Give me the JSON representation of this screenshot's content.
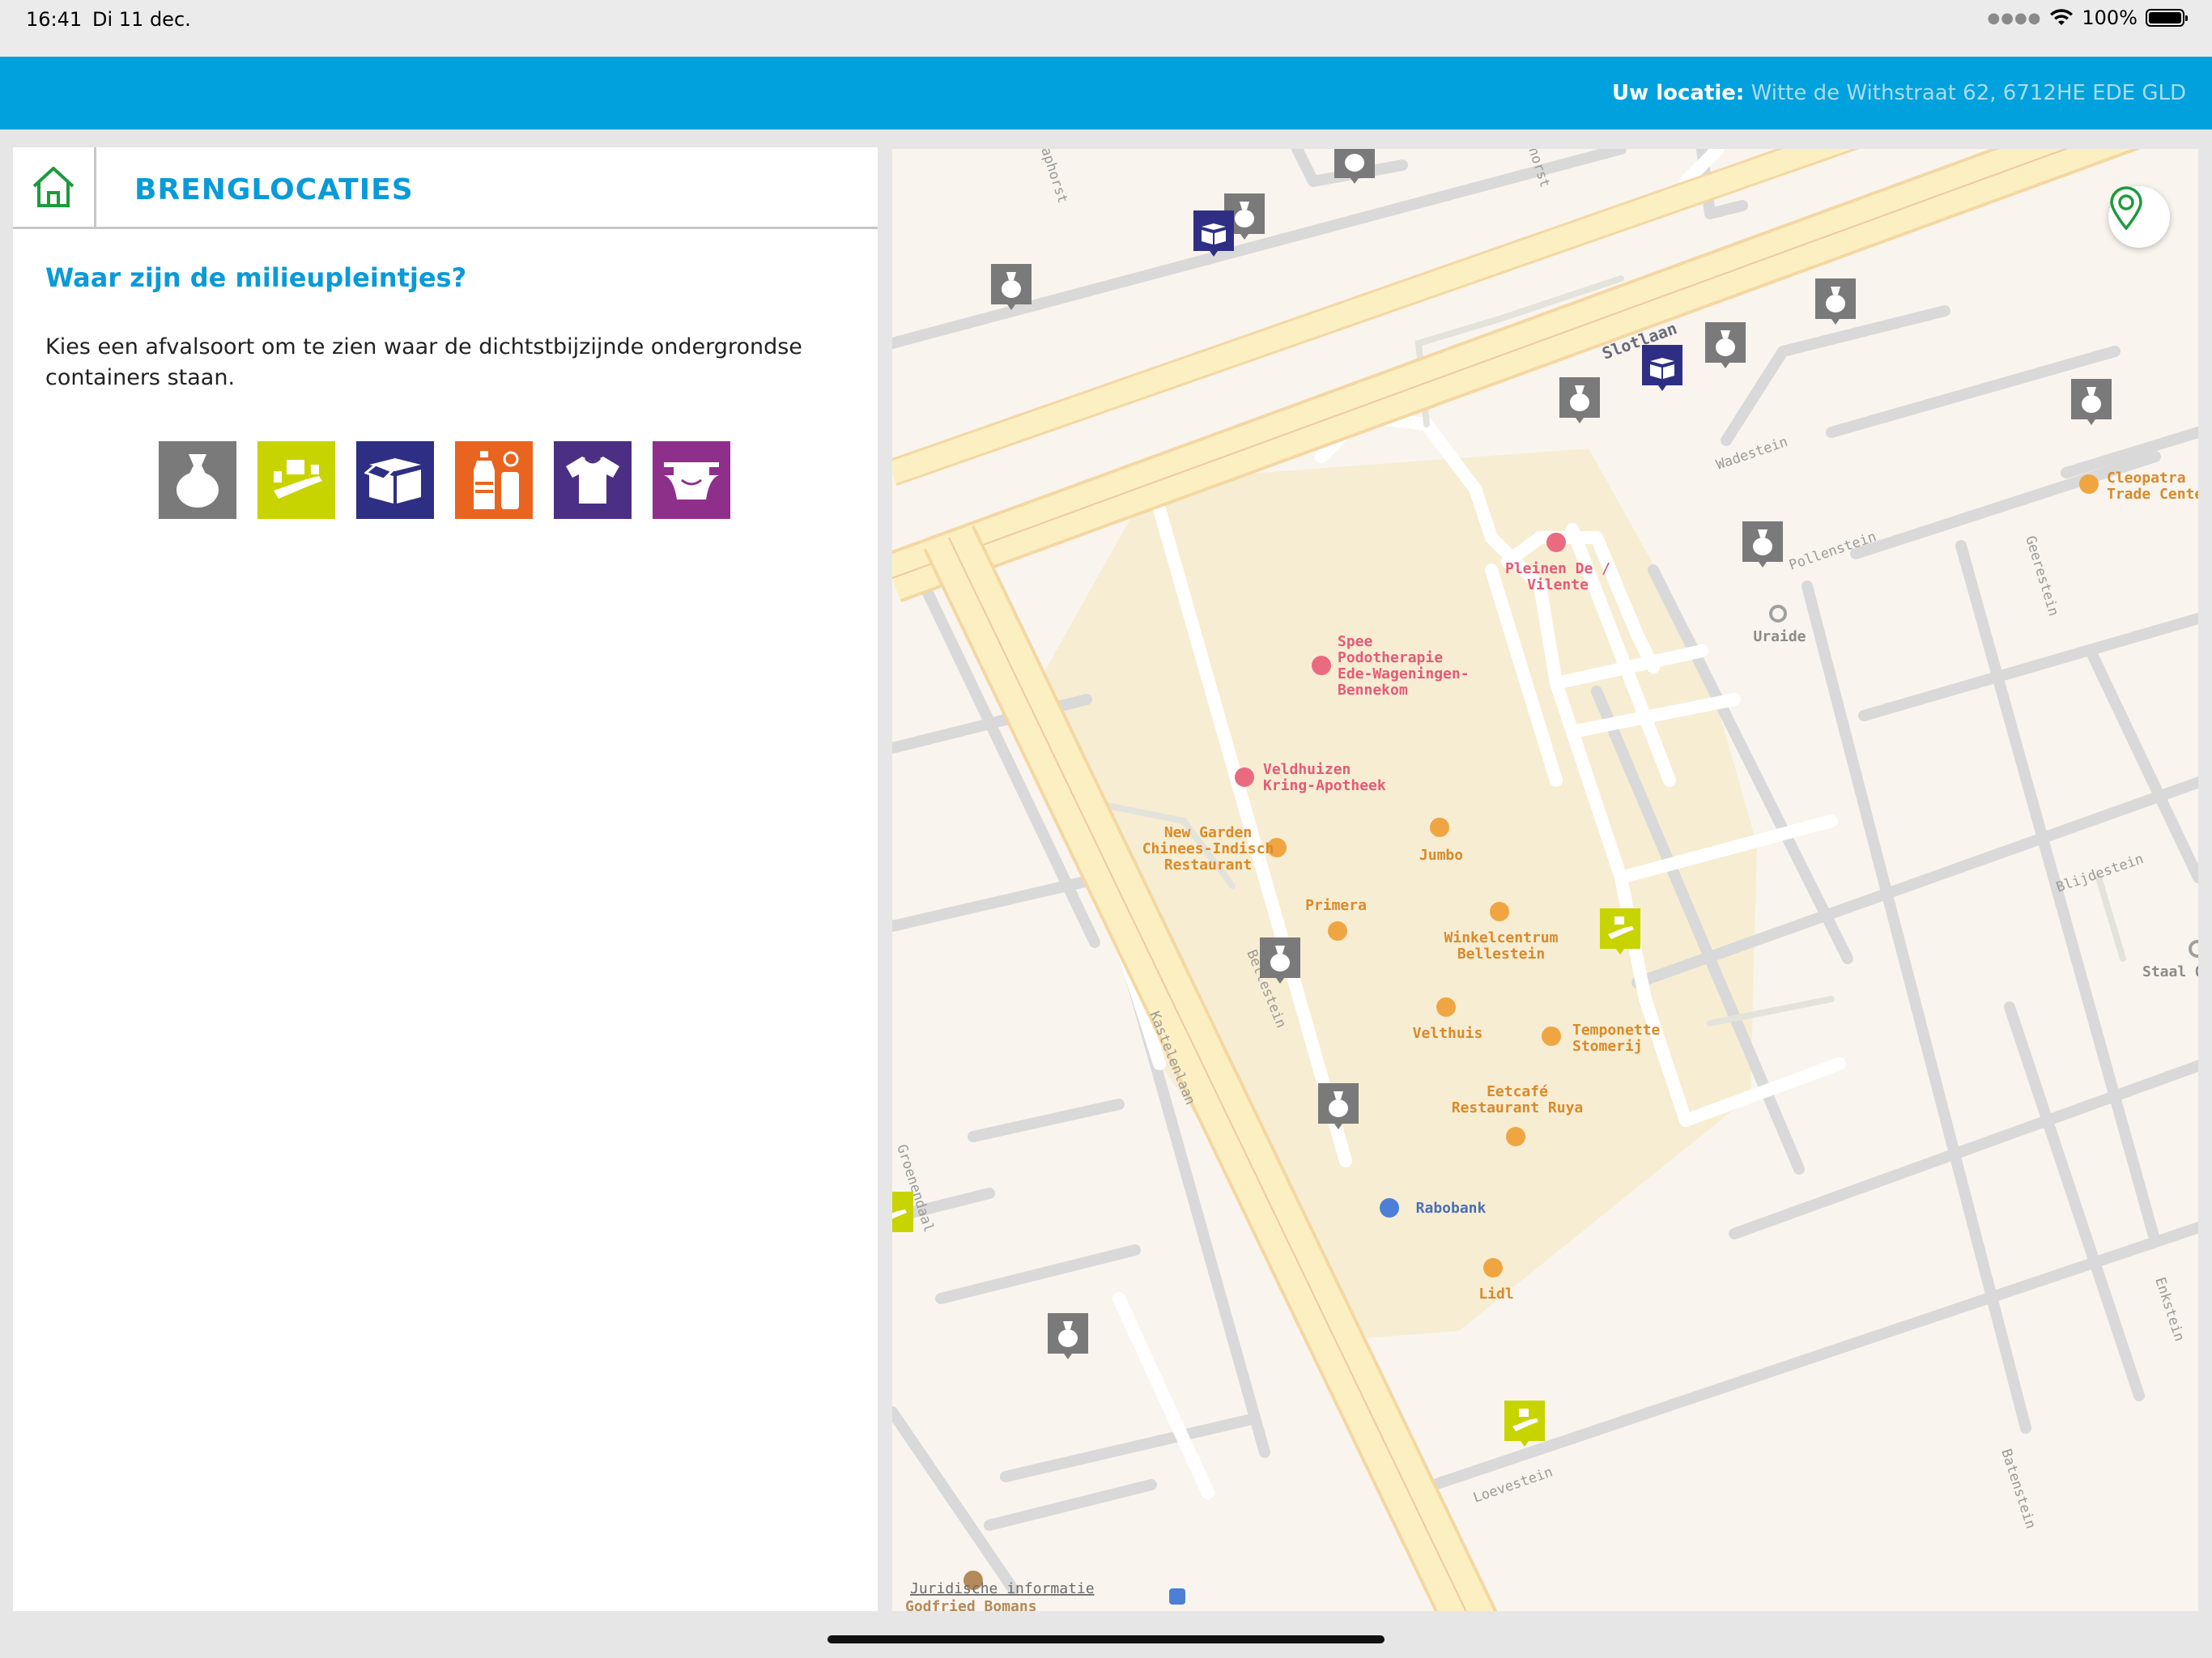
{
  "status_bar": {
    "time": "16:41",
    "date": "Di 11 dec.",
    "battery": "100%"
  },
  "header": {
    "location_label": "Uw locatie:",
    "location_value": "Witte de Withstraat 62, 6712HE EDE GLD"
  },
  "panel": {
    "title": "BRENGLOCATIES",
    "question": "Waar zijn de milieupleintjes?",
    "intro": "Kies een afvalsoort om te zien waar de dichtstbijzijnde ondergrondse containers staan.",
    "categories": [
      {
        "icon": "restafval-bag-icon",
        "color": "#7a7a7a"
      },
      {
        "icon": "glas-bottles-icon",
        "color": "#c8d400"
      },
      {
        "icon": "papier-box-icon",
        "color": "#2e2f84"
      },
      {
        "icon": "plastic-bottle-icon",
        "color": "#e9641f"
      },
      {
        "icon": "textiel-shirt-icon",
        "color": "#4b2f84"
      },
      {
        "icon": "luiers-diaper-icon",
        "color": "#8f2f8c"
      }
    ]
  },
  "map": {
    "streets": [
      "Slotlaan",
      "Wadestein",
      "Pollenstein",
      "Geerestein",
      "Blijdestein",
      "Kastelenlaan",
      "Loevestein",
      "Batenstein",
      "Enkstein",
      "Groenendaal",
      "aphorst",
      "horst",
      "Bellestein"
    ],
    "places": [
      {
        "name": "Pleinen De / Vilente",
        "lines": [
          "Pleinen De /",
          "Vilente"
        ]
      },
      {
        "name": "Spee Podotherapie",
        "lines": [
          "Spee",
          "Podotherapie",
          "Ede-Wageningen-",
          "Bennekom"
        ]
      },
      {
        "name": "Veldhuizen Kring-Apotheek",
        "lines": [
          "Veldhuizen",
          "Kring-Apotheek"
        ]
      },
      {
        "name": "New Garden",
        "lines": [
          "New Garden",
          "Chinees-Indisch",
          "Restaurant"
        ]
      },
      {
        "name": "Jumbo",
        "lines": [
          "Jumbo"
        ]
      },
      {
        "name": "Primera",
        "lines": [
          "Primera"
        ]
      },
      {
        "name": "Winkelcentrum Bellestein",
        "lines": [
          "Winkelcentrum",
          "Bellestein"
        ]
      },
      {
        "name": "Velthuis",
        "lines": [
          "Velthuis"
        ]
      },
      {
        "name": "Temponette",
        "lines": [
          "Temponette",
          "Stomerij"
        ]
      },
      {
        "name": "Eetcafé",
        "lines": [
          "Eetcafé",
          "Restaurant Ruya"
        ]
      },
      {
        "name": "Rabobank",
        "lines": [
          "Rabobank"
        ]
      },
      {
        "name": "Lidl",
        "lines": [
          "Lidl"
        ]
      },
      {
        "name": "Uraide",
        "lines": [
          "Uraide"
        ]
      },
      {
        "name": "Cleopatra",
        "lines": [
          "Cleopatra",
          "Trade Cente"
        ]
      },
      {
        "name": "Staal",
        "lines": [
          "Staal O"
        ]
      },
      {
        "name": "Godfried Bomans",
        "lines": [
          "Godfried Bomans"
        ]
      }
    ],
    "legal": "Juridische informatie",
    "locate_icon": "location-pin-icon"
  }
}
